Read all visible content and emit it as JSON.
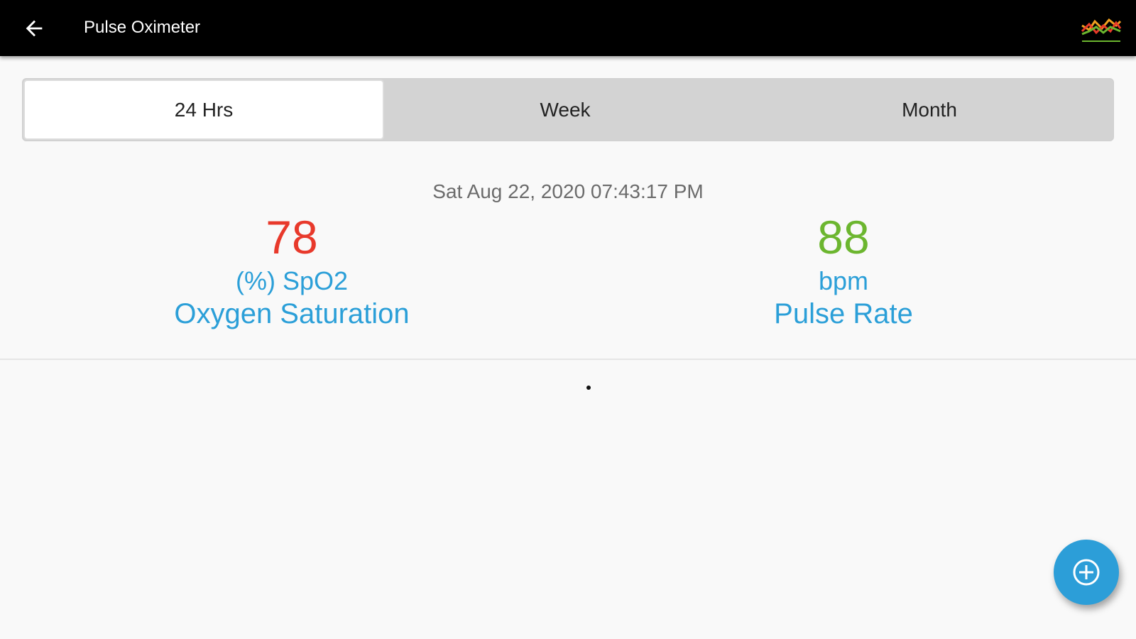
{
  "appbar": {
    "title": "Pulse Oximeter",
    "back_icon": "arrow-left-icon",
    "chart_icon": "trend-chart-icon"
  },
  "tabs": [
    {
      "label": "24 Hrs",
      "active": true
    },
    {
      "label": "Week",
      "active": false
    },
    {
      "label": "Month",
      "active": false
    }
  ],
  "reading": {
    "datetime": "Sat Aug 22, 2020 07:43:17 PM",
    "spo2": {
      "value": "78",
      "unit": "(%) SpO2",
      "label": "Oxygen Saturation",
      "color": "#e8392b"
    },
    "pulse": {
      "value": "88",
      "unit": "bpm",
      "label": "Pulse Rate",
      "color": "#6cb62f"
    }
  },
  "fab": {
    "icon": "add-circle-icon"
  },
  "colors": {
    "appbar_bg": "#000000",
    "accent": "#2b9fd8",
    "background": "#f9f9f9"
  }
}
